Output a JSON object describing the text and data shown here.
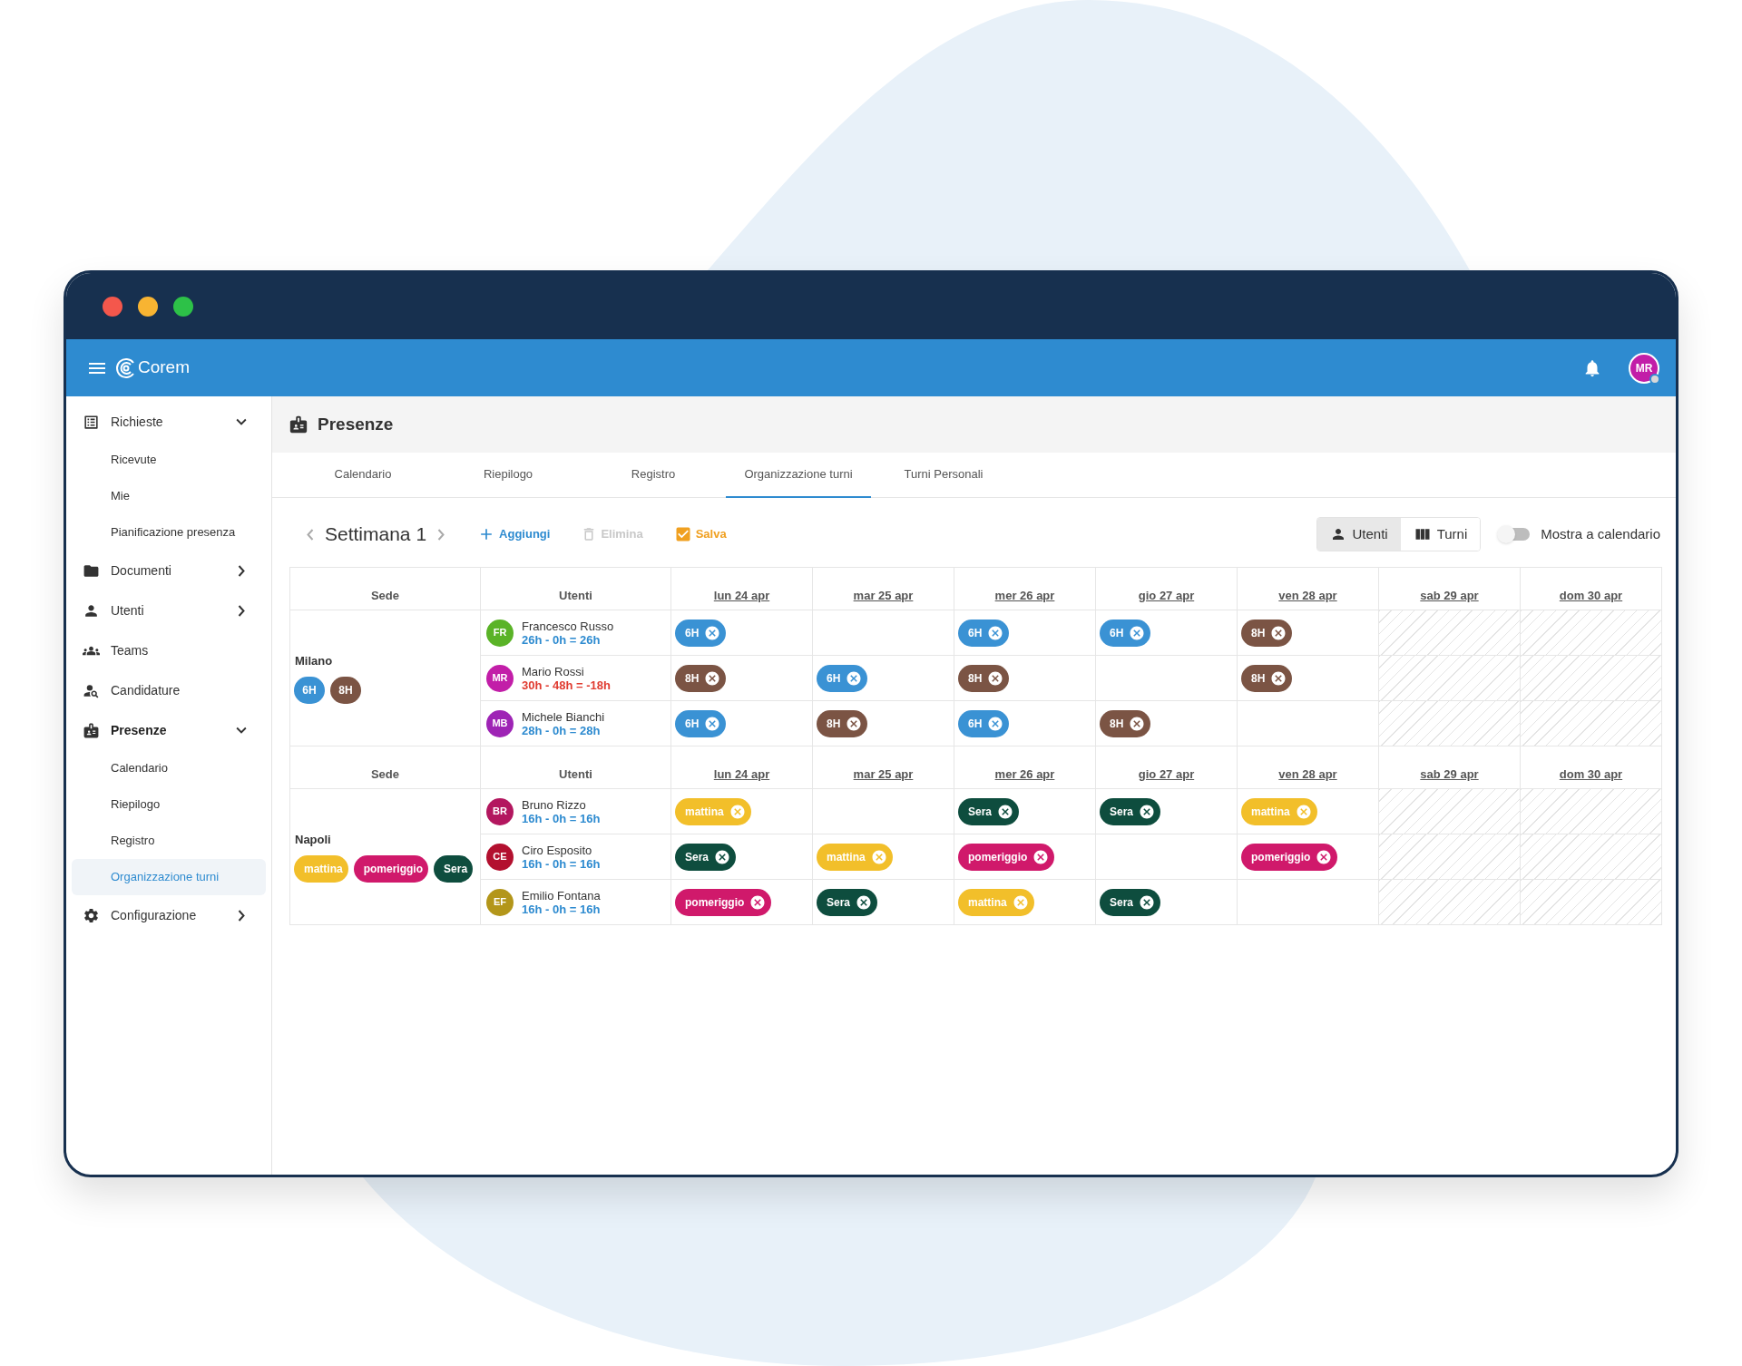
{
  "app_bar": {
    "logo": "Corem",
    "avatar": "MR"
  },
  "sidebar": {
    "items": [
      {
        "kind": "group",
        "label": "Richieste",
        "expanded": true,
        "selected": false,
        "children": [
          {
            "label": "Ricevute",
            "selected": false
          },
          {
            "label": "Mie",
            "selected": false
          },
          {
            "label": "Pianificazione presenza",
            "selected": false
          }
        ]
      },
      {
        "kind": "group",
        "label": "Documenti",
        "expanded": false,
        "selected": false
      },
      {
        "kind": "group",
        "label": "Utenti",
        "expanded": false,
        "selected": false
      },
      {
        "kind": "link",
        "label": "Teams",
        "selected": false
      },
      {
        "kind": "link",
        "label": "Candidature",
        "selected": false
      },
      {
        "kind": "group",
        "label": "Presenze",
        "expanded": true,
        "selected": true,
        "children": [
          {
            "label": "Calendario",
            "selected": false
          },
          {
            "label": "Riepilogo",
            "selected": false
          },
          {
            "label": "Registro",
            "selected": false
          },
          {
            "label": "Organizzazione turni",
            "selected": true
          }
        ]
      },
      {
        "kind": "group",
        "label": "Configurazione",
        "expanded": false,
        "selected": false
      }
    ]
  },
  "page": {
    "title": "Presenze",
    "tabs": [
      {
        "label": "Calendario",
        "selected": false
      },
      {
        "label": "Riepilogo",
        "selected": false
      },
      {
        "label": "Registro",
        "selected": false
      },
      {
        "label": "Organizzazione turni",
        "selected": true
      },
      {
        "label": "Turni Personali",
        "selected": false
      }
    ]
  },
  "toolbar": {
    "week": "Settimana 1",
    "actions": [
      {
        "kind": "add",
        "label": "Aggiungi",
        "disabled": false
      },
      {
        "kind": "delete",
        "label": "Elimina",
        "disabled": true
      },
      {
        "kind": "save",
        "label": "Salva",
        "disabled": false
      }
    ],
    "view_toggle": [
      {
        "kind": "users",
        "label": "Utenti",
        "selected": true
      },
      {
        "kind": "shifts",
        "label": "Turni",
        "selected": false
      }
    ],
    "calendar_switch": {
      "label": "Mostra a calendario",
      "on": false
    }
  },
  "groups": [
    {
      "site_header": "Sede",
      "users_header": "Utenti",
      "days": [
        "lun 24 apr",
        "mar 25 apr",
        "mer 26 apr",
        "gio 27 apr",
        "ven 28 apr",
        "sab 29 apr",
        "dom 30 apr"
      ],
      "site": "Milano",
      "shifts": [
        {
          "label": "6H",
          "color": "#3a92d4"
        },
        {
          "label": "8H",
          "color": "#7b5444"
        }
      ],
      "users": [
        {
          "initials": "FR",
          "color": "#5ab327",
          "name": "Francesco Russo",
          "hours": "26h - 0h = 26h",
          "negative": false,
          "cells": [
            {
              "kind": "shift",
              "label": "6H",
              "color": "#3a92d4"
            },
            {
              "kind": "empty"
            },
            {
              "kind": "shift",
              "label": "6H",
              "color": "#3a92d4"
            },
            {
              "kind": "shift",
              "label": "6H",
              "color": "#3a92d4"
            },
            {
              "kind": "shift",
              "label": "8H",
              "color": "#7b5444"
            },
            {
              "kind": "closed"
            },
            {
              "kind": "closed"
            }
          ]
        },
        {
          "initials": "MR",
          "color": "#c21ea8",
          "name": "Mario Rossi",
          "hours": "30h - 48h = -18h",
          "negative": true,
          "cells": [
            {
              "kind": "shift",
              "label": "8H",
              "color": "#7b5444"
            },
            {
              "kind": "shift",
              "label": "6H",
              "color": "#3a92d4"
            },
            {
              "kind": "shift",
              "label": "8H",
              "color": "#7b5444"
            },
            {
              "kind": "empty"
            },
            {
              "kind": "shift",
              "label": "8H",
              "color": "#7b5444"
            },
            {
              "kind": "closed"
            },
            {
              "kind": "closed"
            }
          ]
        },
        {
          "initials": "MB",
          "color": "#9e24b5",
          "name": "Michele Bianchi",
          "hours": "28h - 0h = 28h",
          "negative": false,
          "cells": [
            {
              "kind": "shift",
              "label": "6H",
              "color": "#3a92d4"
            },
            {
              "kind": "shift",
              "label": "8H",
              "color": "#7b5444"
            },
            {
              "kind": "shift",
              "label": "6H",
              "color": "#3a92d4"
            },
            {
              "kind": "shift",
              "label": "8H",
              "color": "#7b5444"
            },
            {
              "kind": "empty"
            },
            {
              "kind": "closed"
            },
            {
              "kind": "closed"
            }
          ]
        }
      ]
    },
    {
      "site_header": "Sede",
      "users_header": "Utenti",
      "days": [
        "lun 24 apr",
        "mar 25 apr",
        "mer 26 apr",
        "gio 27 apr",
        "ven 28 apr",
        "sab 29 apr",
        "dom 30 apr"
      ],
      "site": "Napoli",
      "shifts": [
        {
          "label": "mattina",
          "color": "#f2bf2a"
        },
        {
          "label": "pomeriggio",
          "color": "#d0196b"
        },
        {
          "label": "Sera",
          "color": "#0e4d3e"
        }
      ],
      "users": [
        {
          "initials": "BR",
          "color": "#b3175f",
          "name": "Bruno Rizzo",
          "hours": "16h - 0h = 16h",
          "negative": false,
          "cells": [
            {
              "kind": "shift",
              "label": "mattina",
              "color": "#f2bf2a"
            },
            {
              "kind": "empty"
            },
            {
              "kind": "shift",
              "label": "Sera",
              "color": "#0e4d3e"
            },
            {
              "kind": "shift",
              "label": "Sera",
              "color": "#0e4d3e"
            },
            {
              "kind": "shift",
              "label": "mattina",
              "color": "#f2bf2a"
            },
            {
              "kind": "closed"
            },
            {
              "kind": "closed"
            }
          ]
        },
        {
          "initials": "CE",
          "color": "#b3102f",
          "name": "Ciro Esposito",
          "hours": "16h - 0h = 16h",
          "negative": false,
          "cells": [
            {
              "kind": "shift",
              "label": "Sera",
              "color": "#0e4d3e"
            },
            {
              "kind": "shift",
              "label": "mattina",
              "color": "#f2bf2a"
            },
            {
              "kind": "shift",
              "label": "pomeriggio",
              "color": "#d0196b"
            },
            {
              "kind": "empty"
            },
            {
              "kind": "shift",
              "label": "pomeriggio",
              "color": "#d0196b"
            },
            {
              "kind": "closed"
            },
            {
              "kind": "closed"
            }
          ]
        },
        {
          "initials": "EF",
          "color": "#b3961a",
          "name": "Emilio Fontana",
          "hours": "16h - 0h = 16h",
          "negative": false,
          "cells": [
            {
              "kind": "shift",
              "label": "pomeriggio",
              "color": "#d0196b"
            },
            {
              "kind": "shift",
              "label": "Sera",
              "color": "#0e4d3e"
            },
            {
              "kind": "shift",
              "label": "mattina",
              "color": "#f2bf2a"
            },
            {
              "kind": "shift",
              "label": "Sera",
              "color": "#0e4d3e"
            },
            {
              "kind": "empty"
            },
            {
              "kind": "closed"
            },
            {
              "kind": "closed"
            }
          ]
        }
      ]
    }
  ]
}
